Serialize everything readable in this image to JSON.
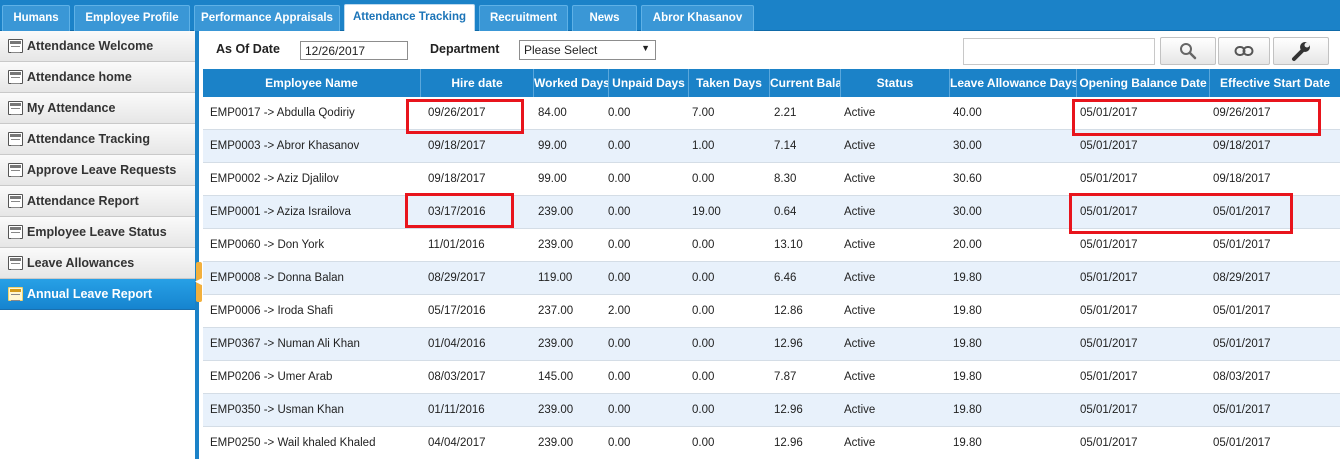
{
  "top_tabs": [
    "Humans",
    "Employee Profile",
    "Performance Appraisals",
    "Attendance Tracking",
    "Recruitment",
    "News",
    "Abror Khasanov"
  ],
  "active_tab": "Attendance Tracking",
  "sidebar": {
    "items": [
      {
        "label": "Attendance Welcome",
        "icon": "calendar-icon"
      },
      {
        "label": "Attendance home",
        "icon": "calendar-icon"
      },
      {
        "label": "My Attendance",
        "icon": "person-list-icon"
      },
      {
        "label": "Attendance Tracking",
        "icon": "report-icon"
      },
      {
        "label": "Approve Leave Requests",
        "icon": "checklist-icon"
      },
      {
        "label": "Attendance Report",
        "icon": "report-icon"
      },
      {
        "label": "Employee Leave Status",
        "icon": "calendar-icon"
      },
      {
        "label": "Leave Allowances",
        "icon": "checklist-icon"
      },
      {
        "label": "Annual Leave Report",
        "icon": "calendar-icon"
      }
    ],
    "active": "Annual Leave Report"
  },
  "filters": {
    "as_of_label": "As Of Date",
    "as_of_value": "12/26/2017",
    "department_label": "Department",
    "department_value": "Please Select",
    "search_value": ""
  },
  "grid": {
    "columns": [
      "Employee Name",
      "Hire date",
      "Worked Days",
      "Unpaid Days",
      "Taken Days",
      "Current Bala",
      "Status",
      "Leave Allowance Days",
      "Opening Balance Date",
      "Effective Start Date"
    ],
    "rows": [
      [
        "EMP0017 -> Abdulla Qodiriy",
        "09/26/2017",
        "84.00",
        "0.00",
        "7.00",
        "2.21",
        "Active",
        "40.00",
        "05/01/2017",
        "09/26/2017"
      ],
      [
        "EMP0003 -> Abror Khasanov",
        "09/18/2017",
        "99.00",
        "0.00",
        "1.00",
        "7.14",
        "Active",
        "30.00",
        "05/01/2017",
        "09/18/2017"
      ],
      [
        "EMP0002 -> Aziz Djalilov",
        "09/18/2017",
        "99.00",
        "0.00",
        "0.00",
        "8.30",
        "Active",
        "30.60",
        "05/01/2017",
        "09/18/2017"
      ],
      [
        "EMP0001 -> Aziza Israilova",
        "03/17/2016",
        "239.00",
        "0.00",
        "19.00",
        "0.64",
        "Active",
        "30.00",
        "05/01/2017",
        "05/01/2017"
      ],
      [
        "EMP0060 -> Don York",
        "11/01/2016",
        "239.00",
        "0.00",
        "0.00",
        "13.10",
        "Active",
        "20.00",
        "05/01/2017",
        "05/01/2017"
      ],
      [
        "EMP0008 -> Donna Balan",
        "08/29/2017",
        "119.00",
        "0.00",
        "0.00",
        "6.46",
        "Active",
        "19.80",
        "05/01/2017",
        "08/29/2017"
      ],
      [
        "EMP0006 -> Iroda Shafi",
        "05/17/2016",
        "237.00",
        "2.00",
        "0.00",
        "12.86",
        "Active",
        "19.80",
        "05/01/2017",
        "05/01/2017"
      ],
      [
        "EMP0367 -> Numan Ali Khan",
        "01/04/2016",
        "239.00",
        "0.00",
        "0.00",
        "12.96",
        "Active",
        "19.80",
        "05/01/2017",
        "05/01/2017"
      ],
      [
        "EMP0206 -> Umer Arab",
        "08/03/2017",
        "145.00",
        "0.00",
        "0.00",
        "7.87",
        "Active",
        "19.80",
        "05/01/2017",
        "08/03/2017"
      ],
      [
        "EMP0350 -> Usman Khan",
        "01/11/2016",
        "239.00",
        "0.00",
        "0.00",
        "12.96",
        "Active",
        "19.80",
        "05/01/2017",
        "05/01/2017"
      ],
      [
        "EMP0250 -> Wail khaled Khaled",
        "04/04/2017",
        "239.00",
        "0.00",
        "0.00",
        "12.96",
        "Active",
        "19.80",
        "05/01/2017",
        "05/01/2017"
      ]
    ]
  },
  "colors": {
    "accent": "#1b82c8",
    "row_alt": "#e8f1fb",
    "highlight": "#e8141c",
    "sidebar_active": "#1684cf"
  }
}
